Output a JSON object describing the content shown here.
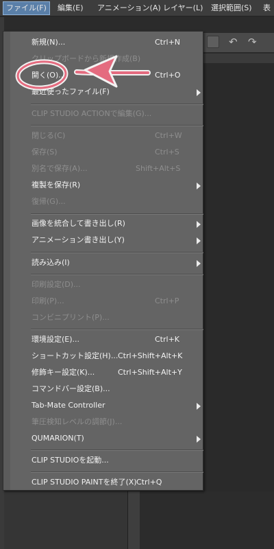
{
  "menubar": {
    "items": [
      {
        "label": "ファイル(F)"
      },
      {
        "label": "編集(E)"
      },
      {
        "label": "アニメーション(A)"
      },
      {
        "label": "レイヤー(L)"
      },
      {
        "label": "選択範囲(S)"
      },
      {
        "label": "表"
      }
    ],
    "active_index": 0
  },
  "file_menu": {
    "items": [
      {
        "label": "新規(N)...",
        "shortcut": "Ctrl+N",
        "enabled": true,
        "submenu": false
      },
      {
        "label": "クリップボードから新規作成(B)",
        "shortcut": "",
        "enabled": false,
        "submenu": false
      },
      {
        "label": "開く(O)...",
        "shortcut": "Ctrl+O",
        "enabled": true,
        "submenu": false
      },
      {
        "label": "最近使ったファイル(F)",
        "shortcut": "",
        "enabled": true,
        "submenu": true
      },
      {
        "label": "CLIP STUDIO ACTIONで編集(G)...",
        "shortcut": "",
        "enabled": false,
        "submenu": false
      },
      {
        "label": "閉じる(C)",
        "shortcut": "Ctrl+W",
        "enabled": false,
        "submenu": false
      },
      {
        "label": "保存(S)",
        "shortcut": "Ctrl+S",
        "enabled": false,
        "submenu": false
      },
      {
        "label": "別名で保存(A)...",
        "shortcut": "Shift+Alt+S",
        "enabled": false,
        "submenu": false
      },
      {
        "label": "複製を保存(R)",
        "shortcut": "",
        "enabled": true,
        "submenu": true
      },
      {
        "label": "復帰(G)...",
        "shortcut": "",
        "enabled": false,
        "submenu": false
      },
      {
        "label": "画像を統合して書き出し(R)",
        "shortcut": "",
        "enabled": true,
        "submenu": true
      },
      {
        "label": "アニメーション書き出し(Y)",
        "shortcut": "",
        "enabled": true,
        "submenu": true
      },
      {
        "label": "読み込み(I)",
        "shortcut": "",
        "enabled": true,
        "submenu": true
      },
      {
        "label": "印刷設定(D)...",
        "shortcut": "",
        "enabled": false,
        "submenu": false
      },
      {
        "label": "印刷(P)...",
        "shortcut": "Ctrl+P",
        "enabled": false,
        "submenu": false
      },
      {
        "label": "コンビニプリント(P)...",
        "shortcut": "",
        "enabled": false,
        "submenu": false
      },
      {
        "label": "環境設定(E)...",
        "shortcut": "Ctrl+K",
        "enabled": true,
        "submenu": false
      },
      {
        "label": "ショートカット設定(H)...",
        "shortcut": "Ctrl+Shift+Alt+K",
        "enabled": true,
        "submenu": false
      },
      {
        "label": "修飾キー設定(K)...",
        "shortcut": "Ctrl+Shift+Alt+Y",
        "enabled": true,
        "submenu": false
      },
      {
        "label": "コマンドバー設定(B)...",
        "shortcut": "",
        "enabled": true,
        "submenu": false
      },
      {
        "label": "Tab-Mate Controller",
        "shortcut": "",
        "enabled": true,
        "submenu": true
      },
      {
        "label": "筆圧検知レベルの調節(J)...",
        "shortcut": "",
        "enabled": false,
        "submenu": false
      },
      {
        "label": "QUMARION(T)",
        "shortcut": "",
        "enabled": true,
        "submenu": true
      },
      {
        "label": "CLIP STUDIOを起動...",
        "shortcut": "",
        "enabled": true,
        "submenu": false
      },
      {
        "label": "CLIP STUDIO PAINTを終了(X)",
        "shortcut": "Ctrl+Q",
        "enabled": true,
        "submenu": false
      }
    ]
  },
  "toolbar": {
    "icons": [
      "save-icon",
      "undo-icon",
      "redo-icon"
    ]
  },
  "annotation": {
    "color": "#e46b7f",
    "highlighted_item": "open-item"
  },
  "colors": {
    "menubar_active": "#5a7fa8",
    "menu_bg": "#646464",
    "text": "#f2f2f2",
    "text_disabled": "#8e8e8e"
  }
}
